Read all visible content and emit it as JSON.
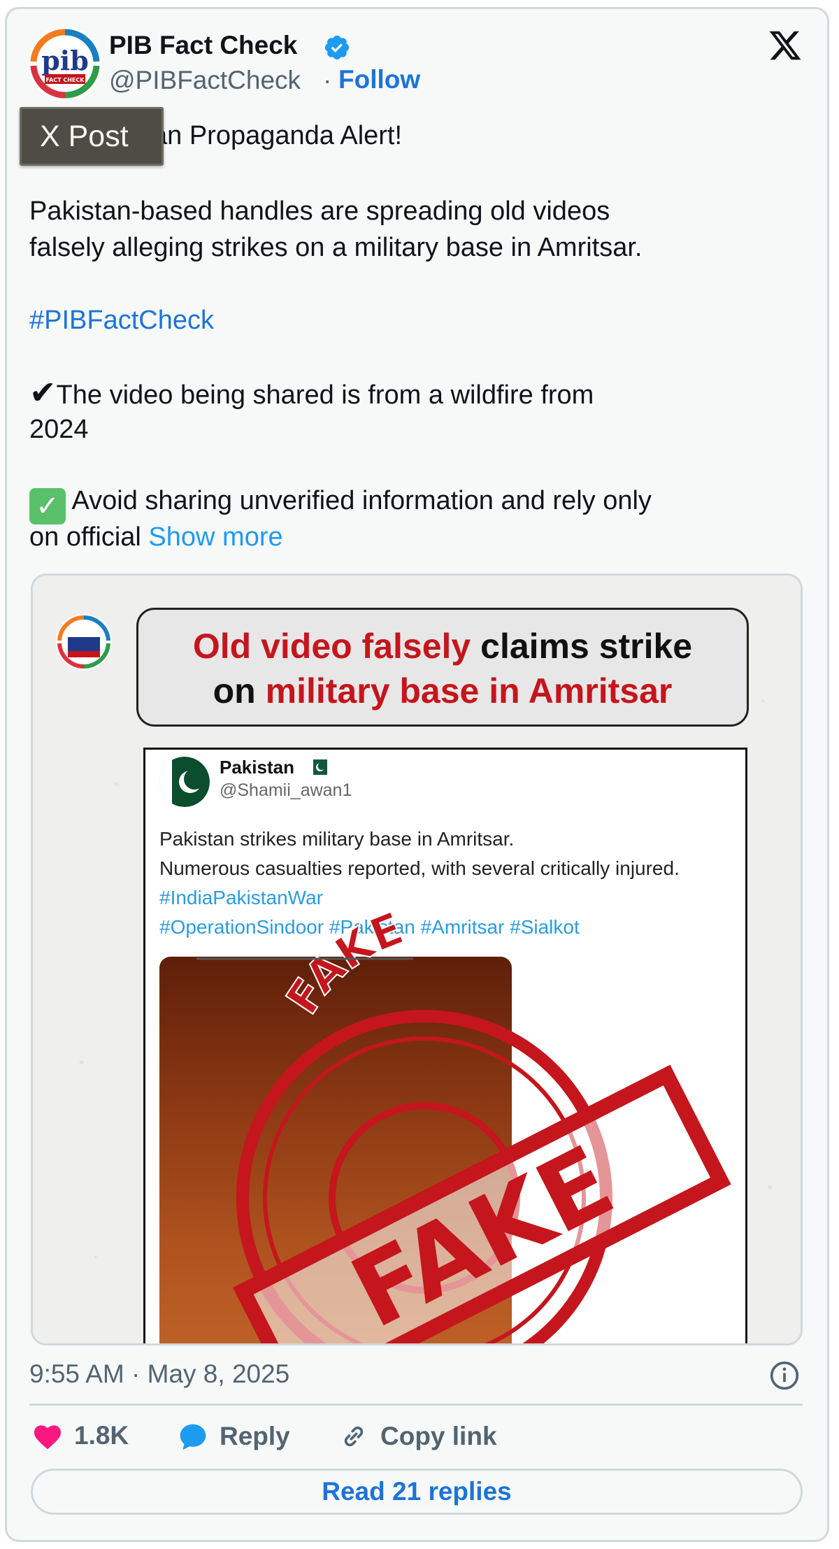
{
  "author": {
    "name": "PIB Fact Check",
    "handle": "@PIBFactCheck",
    "separator": "·",
    "follow_label": "Follow",
    "avatar_text": "pib",
    "avatar_subtext": "FACT CHECK"
  },
  "tooltip": "X Post",
  "post": {
    "line1_partial": "an Propaganda Alert!",
    "line2": "Pakistan-based handles are spreading old videos",
    "line3": "falsely alleging strikes on a military base in Amritsar.",
    "hashtag": "#PIBFactCheck",
    "line4": "The video being shared is from a wildfire from",
    "line5": "2024",
    "line6": "Avoid sharing unverified information and rely only",
    "line7": "on official",
    "show_more": "Show more"
  },
  "media": {
    "headline_red1": "Old video falsely",
    "headline_black1": "claims strike",
    "headline_black2": "on",
    "headline_red2": "military base in Amritsar",
    "shot": {
      "name": "Pakistan",
      "handle": "@Shamii_awan1",
      "text1": "Pakistan strikes military base in Amritsar.",
      "text2": "Numerous casualties reported, with several critically injured.",
      "tag1": "#IndiaPakistanWar",
      "tag2": "#OperationSindoor #Pakistan #Amritsar #Sialkot"
    },
    "stamp_text": "FAKE"
  },
  "footer": {
    "timestamp": "9:55 AM · May 8, 2025",
    "likes": "1.8K",
    "reply_label": "Reply",
    "copy_label": "Copy link",
    "read_replies": "Read 21 replies"
  },
  "colors": {
    "brand_blue": "#1d9bf0",
    "link_blue": "#1d74d6",
    "like_pink": "#f91880",
    "stamp_red": "#c4161c"
  }
}
